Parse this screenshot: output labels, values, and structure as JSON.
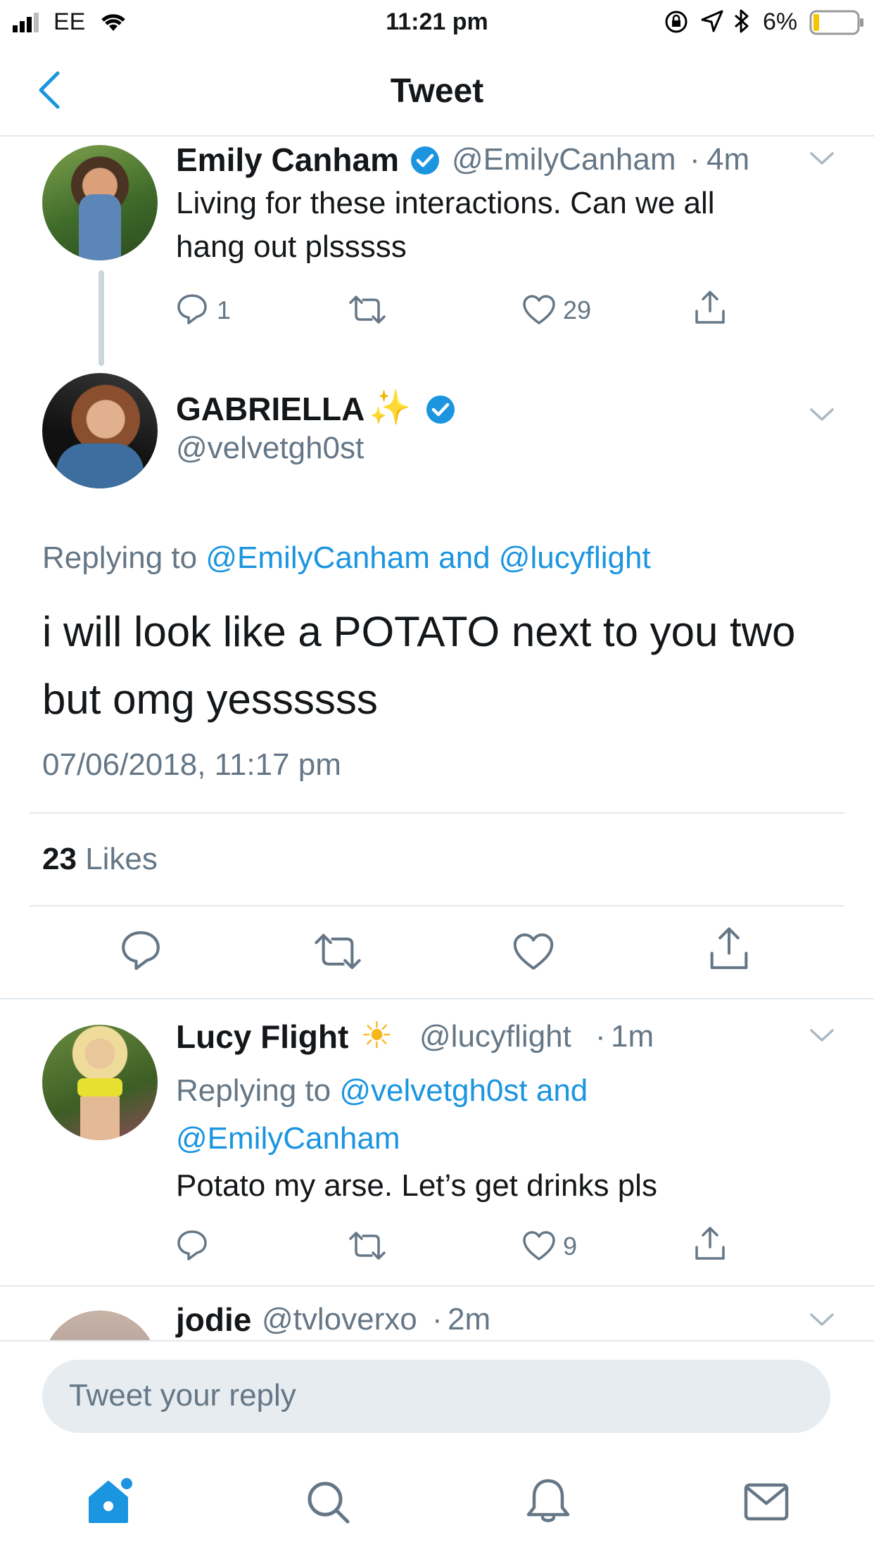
{
  "status_bar": {
    "carrier": "EE",
    "time": "11:21 pm",
    "battery": "6%"
  },
  "header": {
    "title": "Tweet"
  },
  "tweet1": {
    "name": "Emily Canham",
    "handle": "@EmilyCanham",
    "time": "4m",
    "text_line1": "Living for these interactions. Can we all",
    "text_line2": "hang out plsssss",
    "reply_count": "1",
    "like_count": "29"
  },
  "main_tweet": {
    "name": "GABRIELLA",
    "name_emoji": "✨",
    "handle": "@velvetgh0st",
    "replying_prefix": "Replying to",
    "replying_user1": "@EmilyCanham",
    "replying_and": "and",
    "replying_user2": "@lucyflight",
    "text_line1": "i will look like a POTATO next to you two",
    "text_line2": "but omg yessssss",
    "timestamp": "07/06/2018, 11:17 pm",
    "likes_count": "23",
    "likes_label": "Likes"
  },
  "tweet3": {
    "name": "Lucy Flight",
    "name_emoji": "☀",
    "handle": "@lucyflight",
    "time": "1m",
    "replying_prefix": "Replying to",
    "replying_line1_user": "@velvetgh0st",
    "replying_and": "and",
    "replying_line2_user": "@EmilyCanham",
    "text": "Potato my arse. Let’s get drinks pls",
    "like_count": "9"
  },
  "tweet4": {
    "name": "jodie",
    "handle": "@tvloverxo",
    "time": "2m"
  },
  "reply_box": {
    "placeholder": "Tweet your reply"
  },
  "colors": {
    "accent": "#1b95e0",
    "muted": "#657786",
    "divider": "#e1e8ed",
    "battery_low": "#f5c400"
  }
}
